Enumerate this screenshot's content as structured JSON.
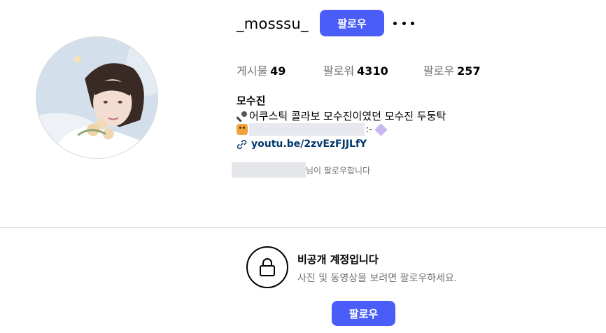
{
  "profile": {
    "username": "_mosssu_",
    "follow_label": "팔로우",
    "stats": {
      "posts_label": "게시물",
      "posts_count": "49",
      "followers_label": "팔로워",
      "followers_count": "4310",
      "following_label": "팔로우",
      "following_count": "257"
    },
    "full_name": "모수진",
    "bio_line1_icon": "microphone-emoji",
    "bio_line1": "어쿠스틱 콜라보 모수진이였던 모수진 두둥탁",
    "bio_line2_tail": "ː-",
    "link": "youtu.be/2zvEzFJJLfY",
    "followed_by_suffix": "님이 팔로우합니다"
  },
  "private": {
    "title": "비공개 계정입니다",
    "description": "사진 및 동영상을 보려면 팔로우하세요.",
    "follow_label": "팔로우"
  },
  "colors": {
    "accent": "#4a5df9",
    "link": "#00376b",
    "muted": "#737373",
    "divider": "#dbdbdb"
  }
}
